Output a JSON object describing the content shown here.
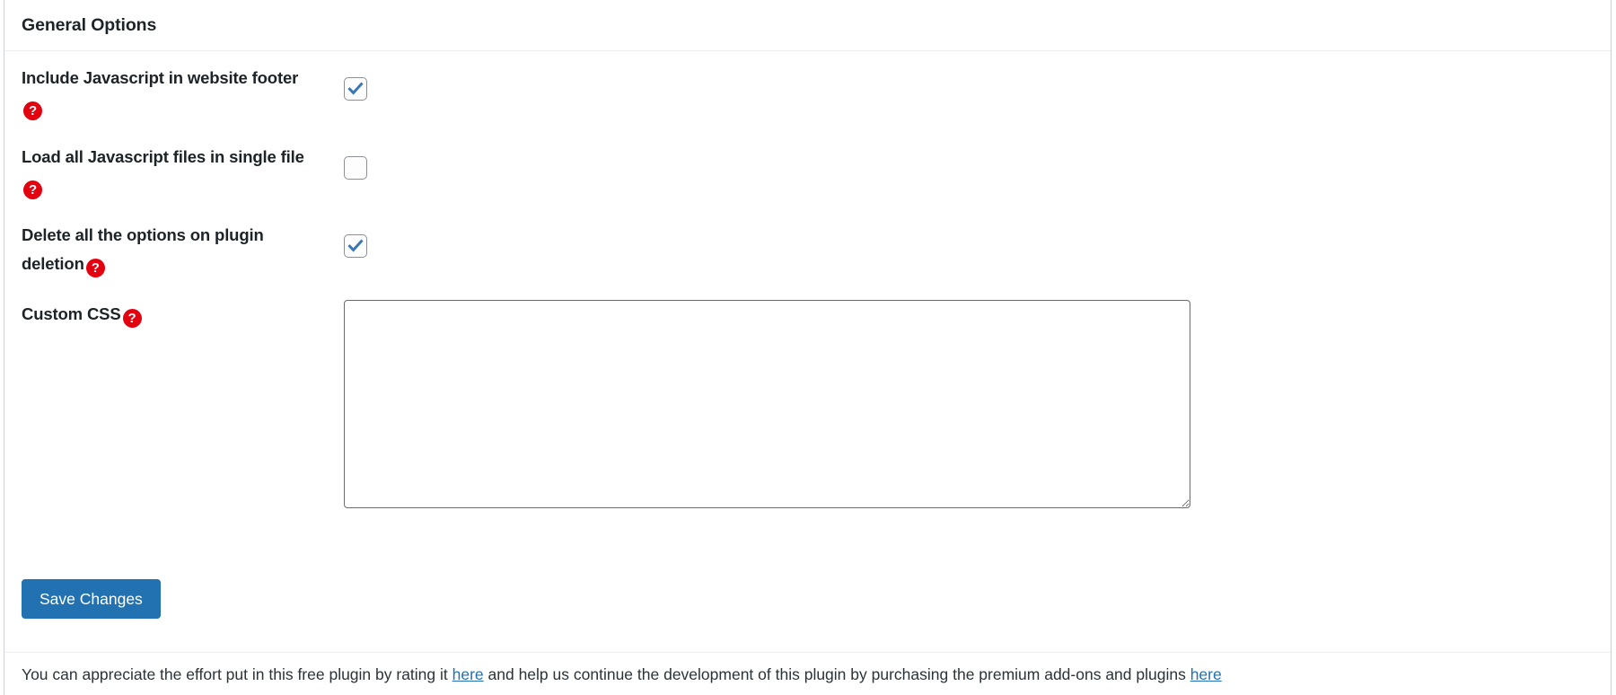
{
  "panel": {
    "title": "General Options",
    "help_glyph": "?"
  },
  "rows": [
    {
      "label": "Include Javascript in website footer",
      "control": "checkbox",
      "checked": true
    },
    {
      "label": "Load all Javascript files in single file",
      "control": "checkbox",
      "checked": false
    },
    {
      "label": "Delete all the options on plugin deletion",
      "control": "checkbox",
      "checked": true
    },
    {
      "label": "Custom CSS",
      "control": "textarea",
      "value": "",
      "placeholder": ""
    }
  ],
  "actions": {
    "save_label": "Save Changes"
  },
  "footer": {
    "text_part1": "You can appreciate the effort put in this free plugin by rating it ",
    "link1_label": "here",
    "text_part2": " and help us continue the development of this plugin by purchasing the premium add-ons and plugins ",
    "link2_label": "here"
  },
  "colors": {
    "accent": "#2271b1",
    "help_icon": "#e3000f",
    "checkmark": "#3c78b4",
    "border": "#ccd0d4",
    "text": "#1d2327"
  }
}
